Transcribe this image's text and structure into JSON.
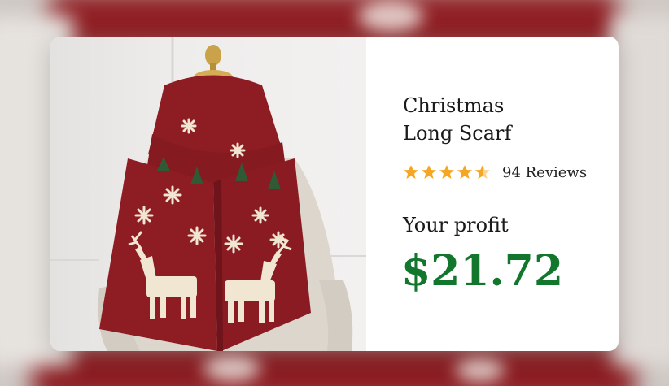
{
  "product": {
    "title": "Christmas\nLong Scarf",
    "rating": 4.5,
    "reviews_label": "94 Reviews",
    "profit_label": "Your profit",
    "profit_value": "$21.72",
    "image_description": "product-photo"
  },
  "colors": {
    "scarf_red": "#8e1c23",
    "pattern_cream": "#f1e6d2",
    "tree_green": "#2f5a35",
    "star_gold": "#f5a623",
    "profit_green": "#12772d"
  }
}
